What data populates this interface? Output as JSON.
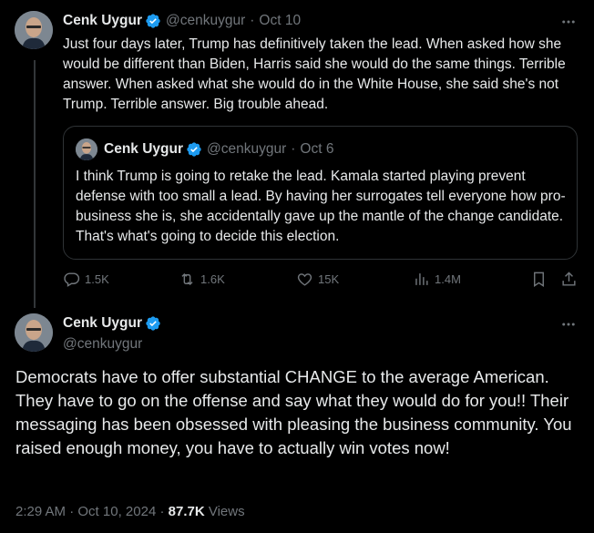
{
  "colors": {
    "background": "#000000",
    "text": "#e7e9ea",
    "muted": "#71767b",
    "verified": "#1d9bf0",
    "border": "#2f3336"
  },
  "parent_tweet": {
    "author_name": "Cenk Uygur",
    "handle": "@cenkuygur",
    "separator": "·",
    "date": "Oct 10",
    "text": "Just four days later, Trump has definitively taken the lead. When asked how she would be different than Biden, Harris said she would do the same things. Terrible answer. When asked what she would do in the White House, she said she's not Trump. Terrible answer. Big trouble ahead.",
    "quoted": {
      "author_name": "Cenk Uygur",
      "handle": "@cenkuygur",
      "separator": "·",
      "date": "Oct 6",
      "text": "I think Trump is going to retake the lead. Kamala started playing prevent defense with too small a lead. By having her surrogates tell everyone how pro-business she is, she accidentally gave up the mantle of the change candidate. That's what's going to decide this election."
    },
    "actions": {
      "replies": "1.5K",
      "reposts": "1.6K",
      "likes": "15K",
      "views": "1.4M"
    }
  },
  "main_tweet": {
    "author_name": "Cenk Uygur",
    "handle": "@cenkuygur",
    "text": "Democrats have to offer substantial CHANGE to the average American. They have to go on the offense and say what they would do for you!! Their messaging has been obsessed with pleasing the business community. You raised enough money, you have to actually win votes now!",
    "time": "2:29 AM",
    "separator": "·",
    "date": "Oct 10, 2024",
    "separator2": "·",
    "views_count": "87.7K",
    "views_label": "Views"
  },
  "icons": [
    "more-icon",
    "verified-icon",
    "reply-icon",
    "repost-icon",
    "like-icon",
    "views-icon",
    "bookmark-icon",
    "share-icon"
  ]
}
